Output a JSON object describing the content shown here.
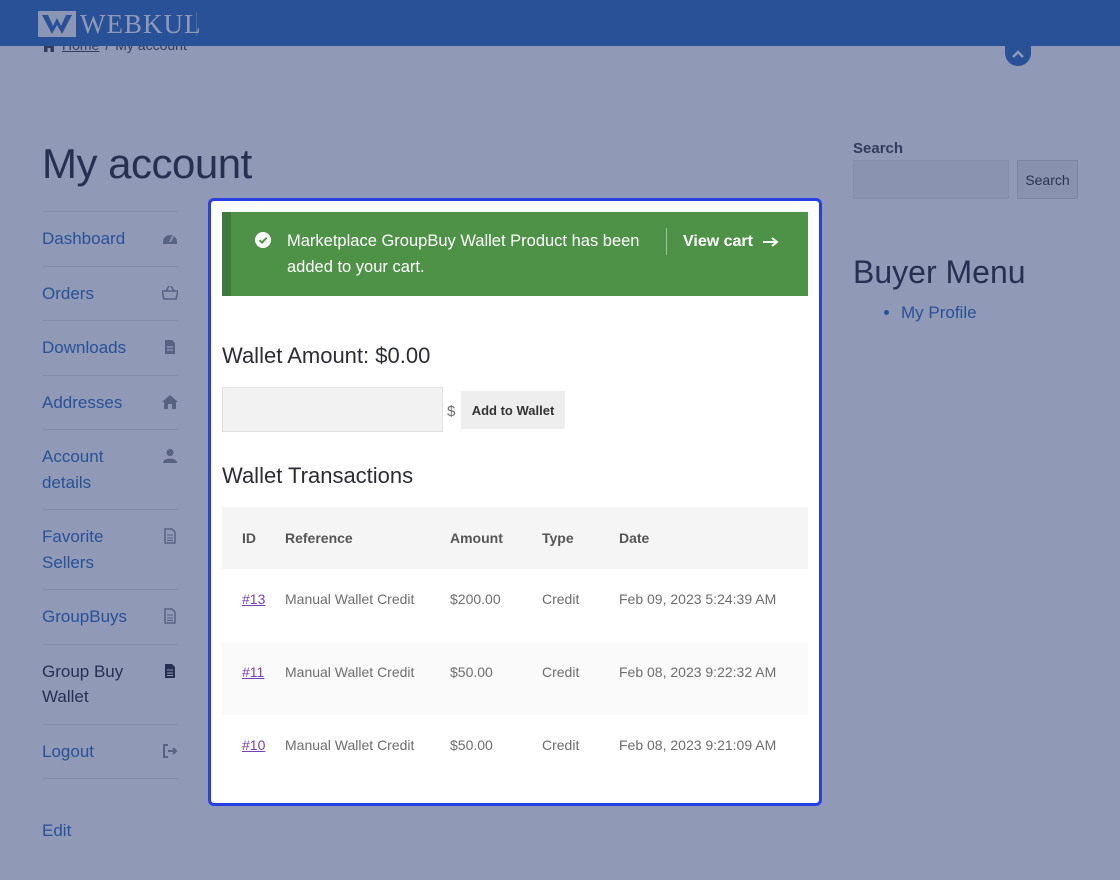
{
  "header": {
    "logo_text": "WEBKUL"
  },
  "breadcrumb": {
    "home": "Home",
    "separator": "/",
    "current": "My account"
  },
  "page": {
    "title": "My account"
  },
  "nav": {
    "items": [
      {
        "label": "Dashboard",
        "icon": "dashboard-icon"
      },
      {
        "label": "Orders",
        "icon": "basket-icon"
      },
      {
        "label": "Downloads",
        "icon": "file-icon"
      },
      {
        "label": "Addresses",
        "icon": "home-icon"
      },
      {
        "label": "Account details",
        "icon": "user-icon"
      },
      {
        "label": "Favorite Sellers",
        "icon": "document-icon"
      },
      {
        "label": "GroupBuys",
        "icon": "document-icon"
      },
      {
        "label": "Group Buy Wallet",
        "icon": "document-icon",
        "active": true
      },
      {
        "label": "Logout",
        "icon": "sign-out-icon"
      }
    ],
    "edit": "Edit"
  },
  "sidebar": {
    "search_label": "Search",
    "search_button": "Search",
    "buyer_menu_title": "Buyer Menu",
    "buyer_menu_items": [
      "My Profile"
    ]
  },
  "modal": {
    "notice": {
      "message": "Marketplace GroupBuy Wallet Product has been added to your cart.",
      "view_cart": "View cart"
    },
    "wallet_amount_label": "Wallet Amount:",
    "wallet_amount_value": "$0.00",
    "currency_symbol": "$",
    "add_button": "Add to Wallet",
    "transactions_title": "Wallet Transactions",
    "table": {
      "headers": [
        "ID",
        "Reference",
        "Amount",
        "Type",
        "Date"
      ],
      "rows": [
        {
          "id": "#13",
          "reference": "Manual Wallet Credit",
          "amount": "$200.00",
          "type": "Credit",
          "date": "Feb 09, 2023 5:24:39 AM"
        },
        {
          "id": "#11",
          "reference": "Manual Wallet Credit",
          "amount": "$50.00",
          "type": "Credit",
          "date": "Feb 08, 2023 9:22:32 AM"
        },
        {
          "id": "#10",
          "reference": "Manual Wallet Credit",
          "amount": "$50.00",
          "type": "Credit",
          "date": "Feb 08, 2023 9:21:09 AM"
        }
      ]
    }
  },
  "colors": {
    "header_blue": "#2e6fc0",
    "link_blue": "#2e6fc0",
    "notice_green": "#4e9247",
    "modal_border": "#2740e4",
    "transaction_link": "#7a3fb0"
  }
}
